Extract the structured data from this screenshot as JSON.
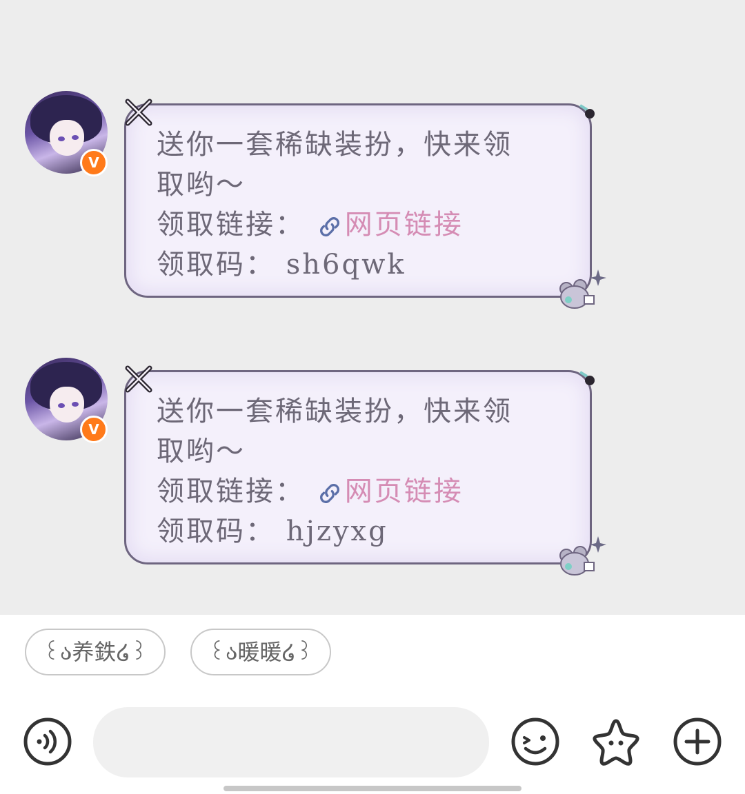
{
  "messages": [
    {
      "line1": "送你一套稀缺装扮，快来领",
      "line2": "取哟～",
      "link_label": "领取链接：",
      "link_text": "网页链接",
      "code_label": "领取码：",
      "code_value": "sh6qwk"
    },
    {
      "line1": "送你一套稀缺装扮，快来领",
      "line2": "取哟～",
      "link_label": "领取链接：",
      "link_text": "网页链接",
      "code_label": "领取码：",
      "code_value": "hjzyxg"
    }
  ],
  "quick_replies": [
    "꒰ა养鉄໒꒱",
    "꒰ა暖暖໒꒱"
  ],
  "input": {
    "placeholder": ""
  },
  "icons": {
    "voice": "voice-icon",
    "emoji": "emoji-icon",
    "star": "star-icon",
    "plus": "plus-icon",
    "link": "link-icon",
    "badge": "v-badge"
  },
  "colors": {
    "chat_bg": "#ededed",
    "bubble_bg": "#f4f0fb",
    "bubble_border": "#6e6580",
    "link": "#d58cb4",
    "badge": "#ff7a1a"
  },
  "badge_text": "V"
}
